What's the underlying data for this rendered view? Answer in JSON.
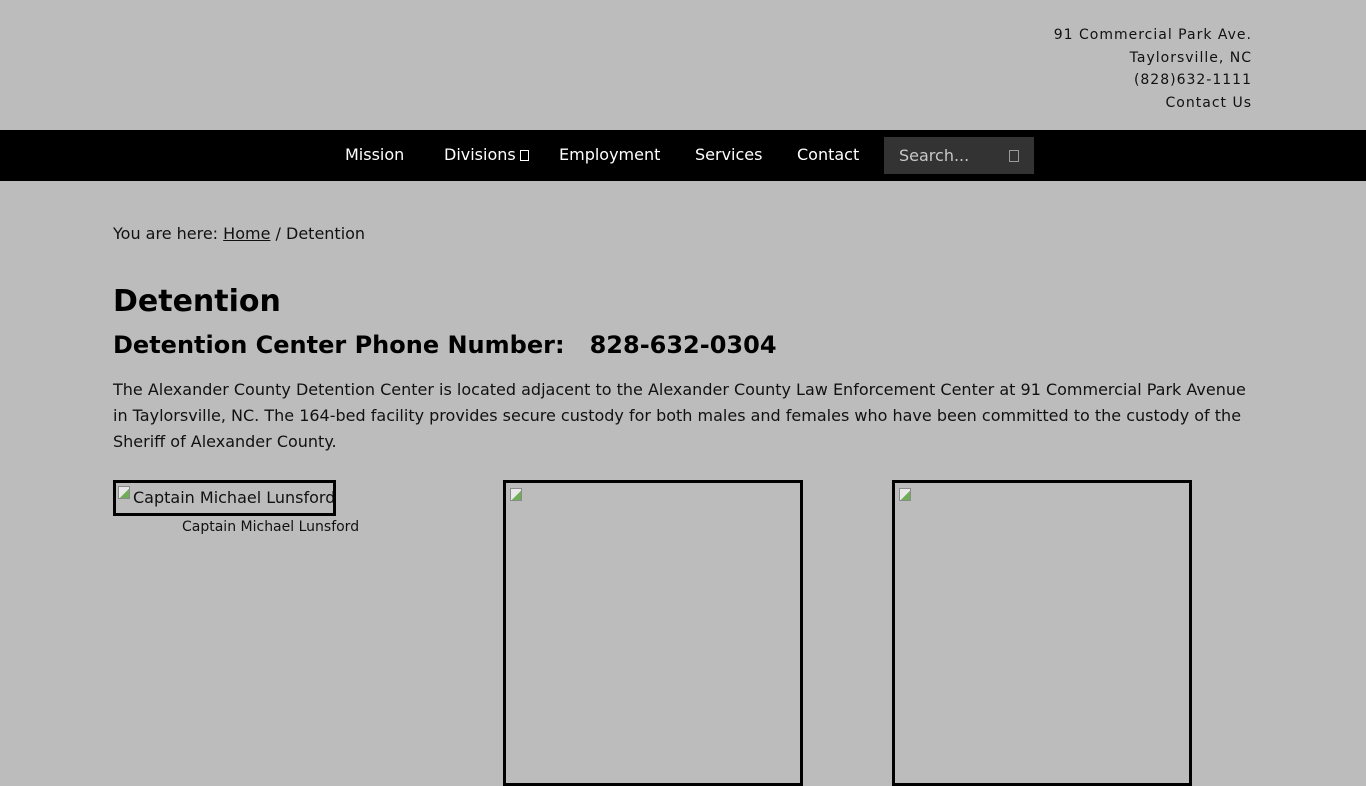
{
  "header": {
    "address_line1": "91 Commercial Park Ave.",
    "address_line2": "Taylorsville, NC",
    "phone": "(828)632-1111",
    "contact_link": "Contact Us"
  },
  "nav": {
    "items": [
      {
        "label": "Mission"
      },
      {
        "label": "Divisions"
      },
      {
        "label": "Employment"
      },
      {
        "label": "Services"
      },
      {
        "label": "Contact"
      }
    ],
    "search_placeholder": "Search...",
    "search_icon": "search-icon",
    "dropdown_icon": "chevron-down-icon"
  },
  "breadcrumb": {
    "prefix": "You are here:",
    "home": "Home",
    "separator": "/",
    "current": "Detention"
  },
  "page": {
    "title": "Detention",
    "subtitle": "Detention Center Phone Number:   828-632-0304",
    "body": "The Alexander County Detention Center is located adjacent to the Alexander County Law Enforcement Center at 91 Commercial Park Avenue in Taylorsville, NC.  The 164-bed facility provides secure custody for both males and females who have been committed to the custody of the Sheriff of Alexander County."
  },
  "images": {
    "captain_alt": "Captain Michael Lunsford",
    "captain_caption": "Captain Michael Lunsford"
  },
  "colors": {
    "background": "#bcbcbc",
    "navbar": "#000000",
    "search_bg": "#333333",
    "text": "#111111"
  }
}
